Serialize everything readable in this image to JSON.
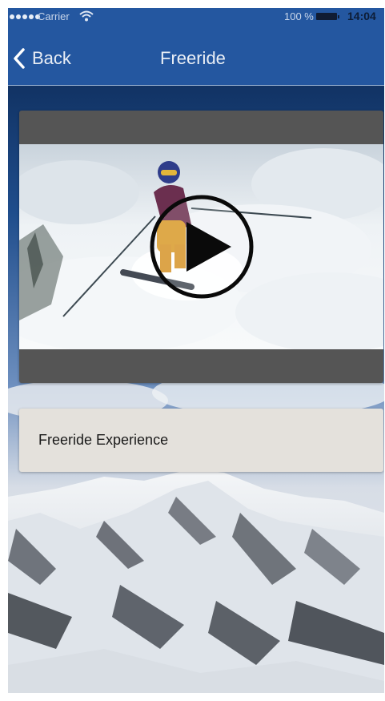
{
  "status_bar": {
    "carrier": "Carrier",
    "battery_percent": "100 %",
    "time": "14:04",
    "signal_icon": "signal-dots-icon",
    "wifi_icon": "wifi-icon",
    "battery_icon": "battery-icon"
  },
  "nav": {
    "back_label": "Back",
    "back_icon": "chevron-left-icon",
    "title": "Freeride"
  },
  "video": {
    "play_icon": "play-icon"
  },
  "item": {
    "title": "Freeride Experience"
  },
  "colors": {
    "nav_bar": "#2457a0",
    "video_card": "#555555",
    "title_card": "#e4e1dc"
  }
}
